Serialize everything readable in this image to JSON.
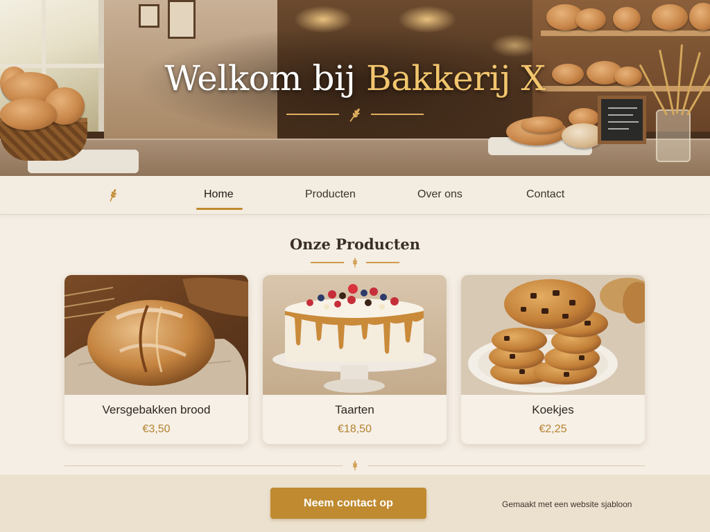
{
  "hero": {
    "title_prefix": "Welkom bij ",
    "title_accent": "Bakkerij X"
  },
  "nav": {
    "logo_icon": "wheat-icon",
    "items": [
      {
        "label": "Home",
        "active": true
      },
      {
        "label": "Producten",
        "active": false
      },
      {
        "label": "Over ons",
        "active": false
      },
      {
        "label": "Contact",
        "active": false
      }
    ]
  },
  "products": {
    "title": "Onze Producten",
    "items": [
      {
        "name": "Versgebakken brood",
        "price": "€3,50",
        "image": "bread-image"
      },
      {
        "name": "Taarten",
        "price": "€18,50",
        "image": "cake-image"
      },
      {
        "name": "Koekjes",
        "price": "€2,25",
        "image": "cookies-image"
      }
    ]
  },
  "footer": {
    "cta_label": "Neem contact op",
    "credit": "Gemaakt met een website sjabloon"
  },
  "colors": {
    "accent": "#c08a30",
    "title_accent": "#f2c56e",
    "background": "#f5eee4",
    "price": "#b5822e"
  }
}
